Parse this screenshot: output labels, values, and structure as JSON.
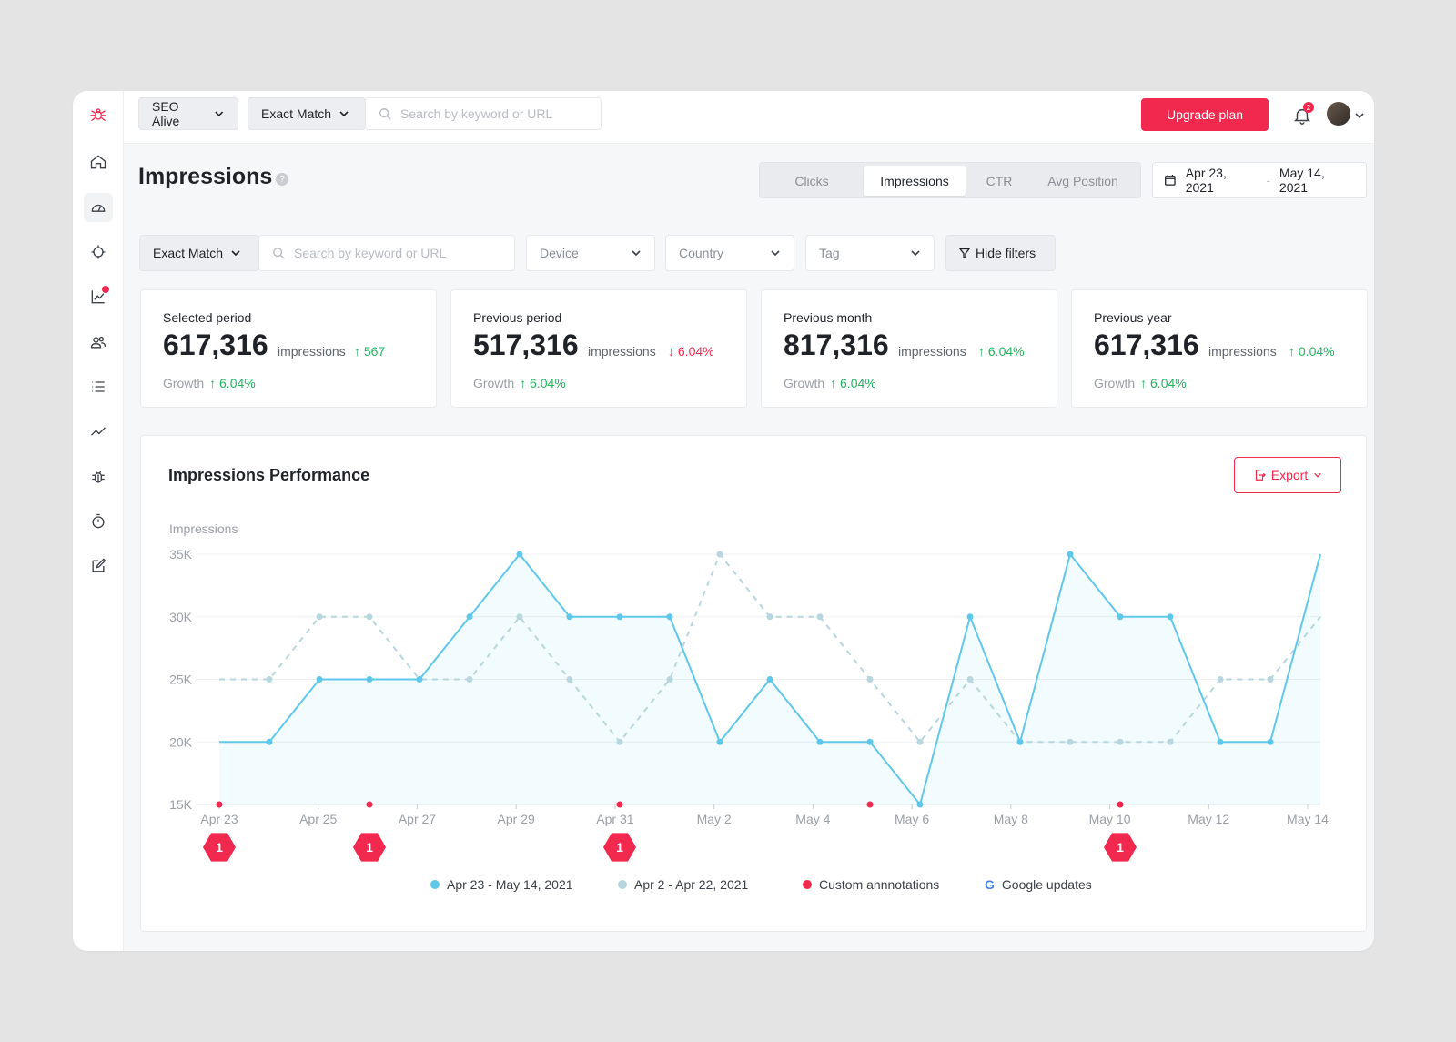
{
  "topbar": {
    "project": "SEO Alive",
    "match": "Exact Match",
    "search_placeholder": "Search by keyword or URL",
    "upgrade": "Upgrade plan",
    "notifications": "2"
  },
  "page": {
    "title": "Impressions",
    "help": "?"
  },
  "tabs": [
    "Clicks",
    "Impressions",
    "CTR",
    "Avg Position"
  ],
  "active_tab": "Impressions",
  "date_range": {
    "start": "Apr 23, 2021",
    "separator": "-",
    "end": "May 14, 2021"
  },
  "filters": {
    "match": "Exact Match",
    "search_placeholder": "Search by keyword or URL",
    "device": "Device",
    "country": "Country",
    "tag": "Tag",
    "hide": "Hide filters"
  },
  "cards": [
    {
      "label": "Selected period",
      "value": "617,316",
      "unit": "impressions",
      "delta": "567",
      "delta_dir": "up",
      "growth_label": "Growth",
      "growth": "6.04%"
    },
    {
      "label": "Previous period",
      "value": "517,316",
      "unit": "impressions",
      "delta": "6.04%",
      "delta_dir": "down",
      "growth_label": "Growth",
      "growth": "6.04%"
    },
    {
      "label": "Previous month",
      "value": "817,316",
      "unit": "impressions",
      "delta": "6.04%",
      "delta_dir": "up",
      "growth_label": "Growth",
      "growth": "6.04%"
    },
    {
      "label": "Previous year",
      "value": "617,316",
      "unit": "impressions",
      "delta": "0.04%",
      "delta_dir": "up",
      "growth_label": "Growth",
      "growth": "6.04%"
    }
  ],
  "chart": {
    "title": "Impressions Performance",
    "export": "Export",
    "legend": {
      "current": "Apr 23 - May 14, 2021",
      "previous": "Apr 2 - Apr 22, 2021",
      "annotations": "Custom annnotations",
      "google": "Google updates"
    }
  },
  "colors": {
    "accent": "#f2294e",
    "current": "#5fc8ea",
    "previous": "#b8d6dd",
    "green": "#22b35e"
  },
  "chart_data": {
    "type": "line",
    "ylabel": "Impressions",
    "ylim": [
      15000,
      35000
    ],
    "yticks": [
      15000,
      20000,
      25000,
      30000,
      35000
    ],
    "ytick_labels": [
      "15K",
      "20K",
      "25K",
      "30K",
      "35K"
    ],
    "x_tick_labels": [
      "Apr 23",
      "Apr 25",
      "Apr 27",
      "Apr 29",
      "Apr 31",
      "May 2",
      "May 4",
      "May 6",
      "May 8",
      "May 10",
      "May 12",
      "May 14"
    ],
    "grid": true,
    "legend_position": "bottom",
    "series": [
      {
        "name": "Apr 23 - May 14, 2021",
        "values": [
          20000,
          20000,
          25000,
          25000,
          25000,
          30000,
          35000,
          30000,
          30000,
          30000,
          20000,
          25000,
          20000,
          20000,
          15000,
          30000,
          20000,
          35000,
          30000,
          30000,
          20000,
          20000,
          35000
        ]
      },
      {
        "name": "Apr 2 - Apr 22, 2021",
        "values": [
          25000,
          25000,
          30000,
          30000,
          25000,
          25000,
          30000,
          25000,
          20000,
          25000,
          35000,
          30000,
          30000,
          25000,
          20000,
          25000,
          20000,
          20000,
          20000,
          20000,
          25000,
          25000,
          30000
        ]
      }
    ],
    "annotations": [
      {
        "index": 0,
        "count": "1"
      },
      {
        "index": 3,
        "count": "1"
      },
      {
        "index": 8,
        "count": "1"
      },
      {
        "index": 13,
        "count": null
      },
      {
        "index": 18,
        "count": "1"
      }
    ]
  }
}
